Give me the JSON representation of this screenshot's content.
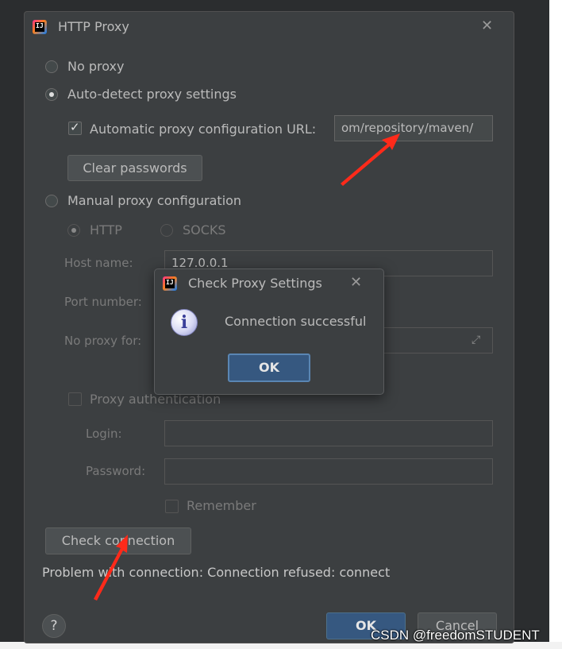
{
  "dialog": {
    "title": "HTTP Proxy",
    "icon": "intellij-app-icon"
  },
  "options": {
    "no_proxy": "No proxy",
    "auto_detect": "Auto-detect proxy settings",
    "auto_config_label": "Automatic proxy configuration URL:",
    "auto_config_value": "om/repository/maven/",
    "clear_passwords": "Clear passwords",
    "manual": "Manual proxy configuration",
    "http": "HTTP",
    "socks": "SOCKS",
    "host_label": "Host name:",
    "host_value": "127.0.0.1",
    "port_label": "Port number:",
    "no_proxy_for_label": "No proxy for:",
    "proxy_auth": "Proxy authentication",
    "login_label": "Login:",
    "password_label": "Password:",
    "remember": "Remember"
  },
  "check_button": "Check connection",
  "status_message": "Problem with connection: Connection refused: connect",
  "footer": {
    "help": "?",
    "ok": "OK",
    "cancel": "Cancel"
  },
  "popup": {
    "title": "Check Proxy Settings",
    "message": "Connection successful",
    "ok": "OK"
  },
  "watermark": "CSDN @freedomSTUDENT",
  "colors": {
    "background": "#3c3f41",
    "accent": "#365880",
    "annotation_arrow": "#ff2a1a"
  }
}
